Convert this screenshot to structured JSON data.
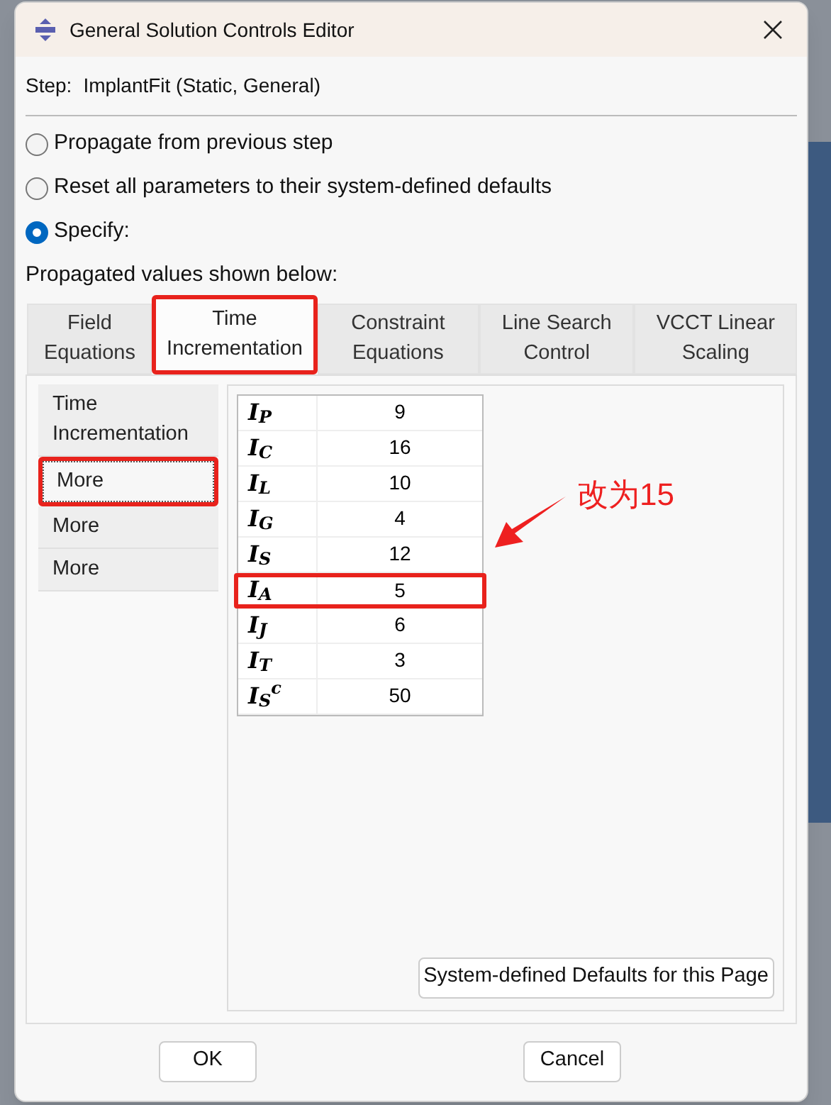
{
  "window": {
    "title": "General Solution Controls Editor"
  },
  "step": {
    "label": "Step:",
    "value": "ImplantFit (Static, General)"
  },
  "options": [
    {
      "label": "Propagate from previous step",
      "selected": false
    },
    {
      "label": "Reset all parameters to their system-defined defaults",
      "selected": false
    },
    {
      "label": "Specify:",
      "selected": true
    }
  ],
  "note": "Propagated values shown below:",
  "tabs": [
    {
      "label": "Field Equations",
      "selected": false,
      "highlighted": false
    },
    {
      "label": "Time Incrementation",
      "selected": true,
      "highlighted": true
    },
    {
      "label": "Constraint Equations",
      "selected": false,
      "highlighted": false
    },
    {
      "label": "Line Search Control",
      "selected": false,
      "highlighted": false
    },
    {
      "label": "VCCT Linear Scaling",
      "selected": false,
      "highlighted": false
    }
  ],
  "sidebar": {
    "items": [
      {
        "label": "Time Incrementation",
        "selected": false,
        "highlighted": false
      },
      {
        "label": "More",
        "selected": true,
        "highlighted": true
      },
      {
        "label": "More",
        "selected": false,
        "highlighted": false
      },
      {
        "label": "More",
        "selected": false,
        "highlighted": false
      }
    ]
  },
  "table": {
    "rows": [
      {
        "name": "I$_{P}$",
        "value": "9",
        "highlighted": false
      },
      {
        "name": "I$_{C}$",
        "value": "16",
        "highlighted": false
      },
      {
        "name": "I$_{L}$",
        "value": "10",
        "highlighted": false
      },
      {
        "name": "I$_{G}$",
        "value": "4",
        "highlighted": false
      },
      {
        "name": "I$_{S}$",
        "value": "12",
        "highlighted": false
      },
      {
        "name": "I$_{A}$",
        "value": "5",
        "highlighted": true
      },
      {
        "name": "I$_{J}$",
        "value": "6",
        "highlighted": false
      },
      {
        "name": "I$_{T}$",
        "value": "3",
        "highlighted": false
      },
      {
        "name": "I$_{S}$$^{c}$",
        "value": "50",
        "highlighted": false
      }
    ]
  },
  "annotation": "改为15",
  "defaults_button": "System-defined Defaults for this Page",
  "buttons": [
    "OK",
    "Cancel"
  ]
}
